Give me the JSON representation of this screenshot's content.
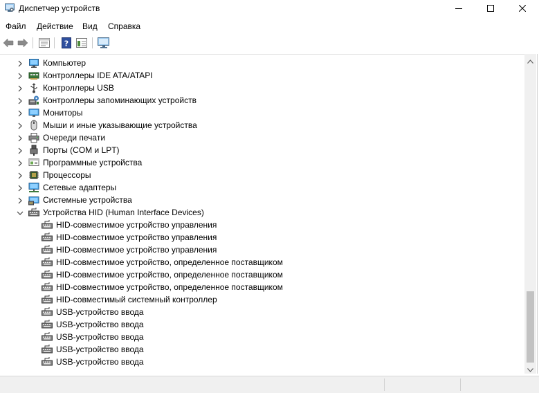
{
  "window": {
    "title": "Диспетчер устройств",
    "minimize_glyph": "—",
    "maximize_glyph": "☐",
    "close_glyph": "✕"
  },
  "menu": [
    "Файл",
    "Действие",
    "Вид",
    "Справка"
  ],
  "toolbar": {
    "buttons": [
      "back-icon",
      "forward-icon",
      "properties-icon",
      "help-icon",
      "view-icon",
      "monitor-scan-icon"
    ]
  },
  "tree": [
    {
      "label": "Компьютер",
      "level": 0,
      "expanded": false,
      "icon": "computer-icon"
    },
    {
      "label": "Контроллеры IDE ATA/ATAPI",
      "level": 0,
      "expanded": false,
      "icon": "ide-controller-icon"
    },
    {
      "label": "Контроллеры USB",
      "level": 0,
      "expanded": false,
      "icon": "usb-icon"
    },
    {
      "label": "Контроллеры запоминающих устройств",
      "level": 0,
      "expanded": false,
      "icon": "storage-controller-icon"
    },
    {
      "label": "Мониторы",
      "level": 0,
      "expanded": false,
      "icon": "monitor-icon"
    },
    {
      "label": "Мыши и иные указывающие устройства",
      "level": 0,
      "expanded": false,
      "icon": "mouse-icon"
    },
    {
      "label": "Очереди печати",
      "level": 0,
      "expanded": false,
      "icon": "printer-icon"
    },
    {
      "label": "Порты (COM и LPT)",
      "level": 0,
      "expanded": false,
      "icon": "port-icon"
    },
    {
      "label": "Программные устройства",
      "level": 0,
      "expanded": false,
      "icon": "software-device-icon"
    },
    {
      "label": "Процессоры",
      "level": 0,
      "expanded": false,
      "icon": "processor-icon"
    },
    {
      "label": "Сетевые адаптеры",
      "level": 0,
      "expanded": false,
      "icon": "network-adapter-icon"
    },
    {
      "label": "Системные устройства",
      "level": 0,
      "expanded": false,
      "icon": "system-device-icon"
    },
    {
      "label": "Устройства HID (Human Interface Devices)",
      "level": 0,
      "expanded": true,
      "icon": "hid-icon"
    },
    {
      "label": "HID-совместимое устройство управления",
      "level": 1,
      "icon": "hid-icon"
    },
    {
      "label": "HID-совместимое устройство управления",
      "level": 1,
      "icon": "hid-icon"
    },
    {
      "label": "HID-совместимое устройство управления",
      "level": 1,
      "icon": "hid-icon"
    },
    {
      "label": "HID-совместимое устройство, определенное поставщиком",
      "level": 1,
      "icon": "hid-icon"
    },
    {
      "label": "HID-совместимое устройство, определенное поставщиком",
      "level": 1,
      "icon": "hid-icon"
    },
    {
      "label": "HID-совместимое устройство, определенное поставщиком",
      "level": 1,
      "icon": "hid-icon"
    },
    {
      "label": "HID-совместимый системный контроллер",
      "level": 1,
      "icon": "hid-icon"
    },
    {
      "label": "USB-устройство ввода",
      "level": 1,
      "icon": "hid-icon"
    },
    {
      "label": "USB-устройство ввода",
      "level": 1,
      "icon": "hid-icon"
    },
    {
      "label": "USB-устройство ввода",
      "level": 1,
      "icon": "hid-icon"
    },
    {
      "label": "USB-устройство ввода",
      "level": 1,
      "icon": "hid-icon"
    },
    {
      "label": "USB-устройство ввода",
      "level": 1,
      "icon": "hid-icon"
    }
  ],
  "colors": {
    "accent": "#1e78d6",
    "selection": "#cce8ff"
  }
}
